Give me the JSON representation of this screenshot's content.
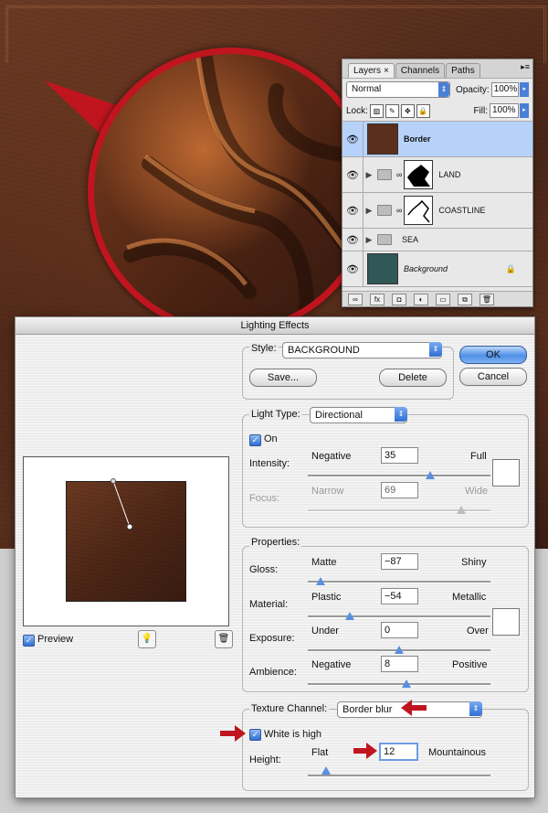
{
  "layers_panel": {
    "tabs": [
      "Layers",
      "Channels",
      "Paths"
    ],
    "active_tab_close": "×",
    "blend_mode": "Normal",
    "opacity_label": "Opacity:",
    "opacity_value": "100%",
    "lock_label": "Lock:",
    "fill_label": "Fill:",
    "fill_value": "100%",
    "layers": [
      {
        "name": "Border",
        "selected": true
      },
      {
        "name": "LAND"
      },
      {
        "name": "COASTLINE"
      },
      {
        "name": "SEA"
      },
      {
        "name": "Background",
        "italic": true
      }
    ],
    "footer_icons": [
      "link-icon",
      "fx-icon",
      "mask-icon",
      "adjustment-icon",
      "group-icon",
      "new-layer-icon",
      "trash-icon"
    ],
    "fx_label": "fx"
  },
  "dialog": {
    "title": "Lighting Effects",
    "style_label": "Style:",
    "style_value": "BACKGROUND",
    "save_button": "Save...",
    "delete_button": "Delete",
    "ok_button": "OK",
    "cancel_button": "Cancel",
    "light_type_label": "Light Type:",
    "light_type_value": "Directional",
    "on_label": "On",
    "on_checked": true,
    "intensity": {
      "label": "Intensity:",
      "min": "Negative",
      "max": "Full",
      "value": "35",
      "fraction": 0.67
    },
    "focus": {
      "label": "Focus:",
      "min": "Narrow",
      "max": "Wide",
      "value": "69",
      "fraction": 0.84
    },
    "properties_label": "Properties:",
    "gloss": {
      "label": "Gloss:",
      "min": "Matte",
      "max": "Shiny",
      "value": "−87",
      "fraction": 0.07
    },
    "material": {
      "label": "Material:",
      "min": "Plastic",
      "max": "Metallic",
      "value": "−54",
      "fraction": 0.23
    },
    "exposure": {
      "label": "Exposure:",
      "min": "Under",
      "max": "Over",
      "value": "0",
      "fraction": 0.5
    },
    "ambience": {
      "label": "Ambience:",
      "min": "Negative",
      "max": "Positive",
      "value": "8",
      "fraction": 0.54
    },
    "texture_channel_label": "Texture Channel:",
    "texture_channel_value": "Border blur",
    "white_is_high_label": "White is high",
    "white_is_high_checked": true,
    "height": {
      "label": "Height:",
      "min": "Flat",
      "max": "Mountainous",
      "value": "12",
      "fraction": 0.1
    },
    "preview_label": "Preview",
    "preview_checked": true
  },
  "colors": {
    "accent": "#c0151f",
    "selected_layer": "#b7d2fa",
    "button_blue": "#4f8fe6"
  }
}
